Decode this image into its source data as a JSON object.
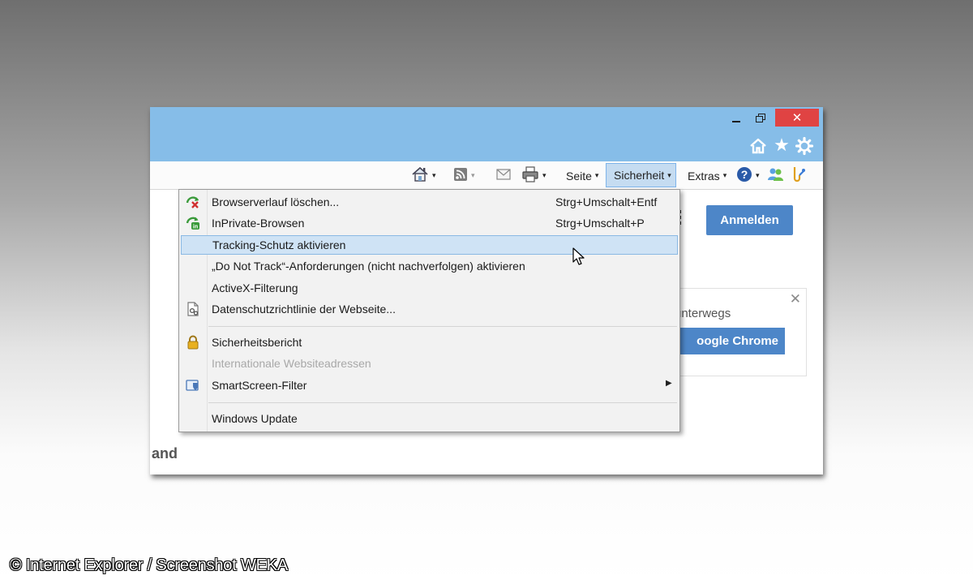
{
  "window": {
    "controls": {
      "close_symbol": "✕"
    },
    "favbar": {
      "star_symbol": "★"
    }
  },
  "commandbar": {
    "seite_label": "Seite",
    "sicherheit_label": "Sicherheit",
    "extras_label": "Extras",
    "caret": "▾"
  },
  "page": {
    "login_label": "Anmelden",
    "promo_text": "unterwegs",
    "chrome_button_label": "oogle Chrome",
    "promo_close": "✕",
    "fragment_text": "and"
  },
  "menu": {
    "items": [
      {
        "label": "Browserverlauf löschen...",
        "shortcut": "Strg+Umschalt+Entf",
        "icon": "delete-history-icon"
      },
      {
        "label": "InPrivate-Browsen",
        "shortcut": "Strg+Umschalt+P",
        "icon": "inprivate-icon"
      },
      {
        "label": "Tracking-Schutz aktivieren",
        "shortcut": "",
        "icon": "",
        "highlighted": true
      },
      {
        "label": "„Do Not Track“-Anforderungen (nicht nachverfolgen) aktivieren",
        "shortcut": "",
        "icon": ""
      },
      {
        "label": "ActiveX-Filterung",
        "shortcut": "",
        "icon": ""
      },
      {
        "label": "Datenschutzrichtlinie der Webseite...",
        "shortcut": "",
        "icon": "privacy-policy-icon"
      },
      {
        "label": "Sicherheitsbericht",
        "shortcut": "",
        "icon": "lock-icon"
      },
      {
        "label": "Internationale Websiteadressen",
        "shortcut": "",
        "icon": "",
        "disabled": true
      },
      {
        "label": "SmartScreen-Filter",
        "shortcut": "",
        "icon": "smartscreen-icon",
        "submenu": true
      },
      {
        "label": "Windows Update",
        "shortcut": "",
        "icon": ""
      }
    ],
    "submenu_arrow": "▶"
  },
  "caption": "© Internet Explorer / Screenshot WEKA",
  "colors": {
    "titlebar": "#86bde8",
    "close_button": "#e04343",
    "highlight": "#cfe3f5",
    "page_button": "#4d86c8"
  }
}
